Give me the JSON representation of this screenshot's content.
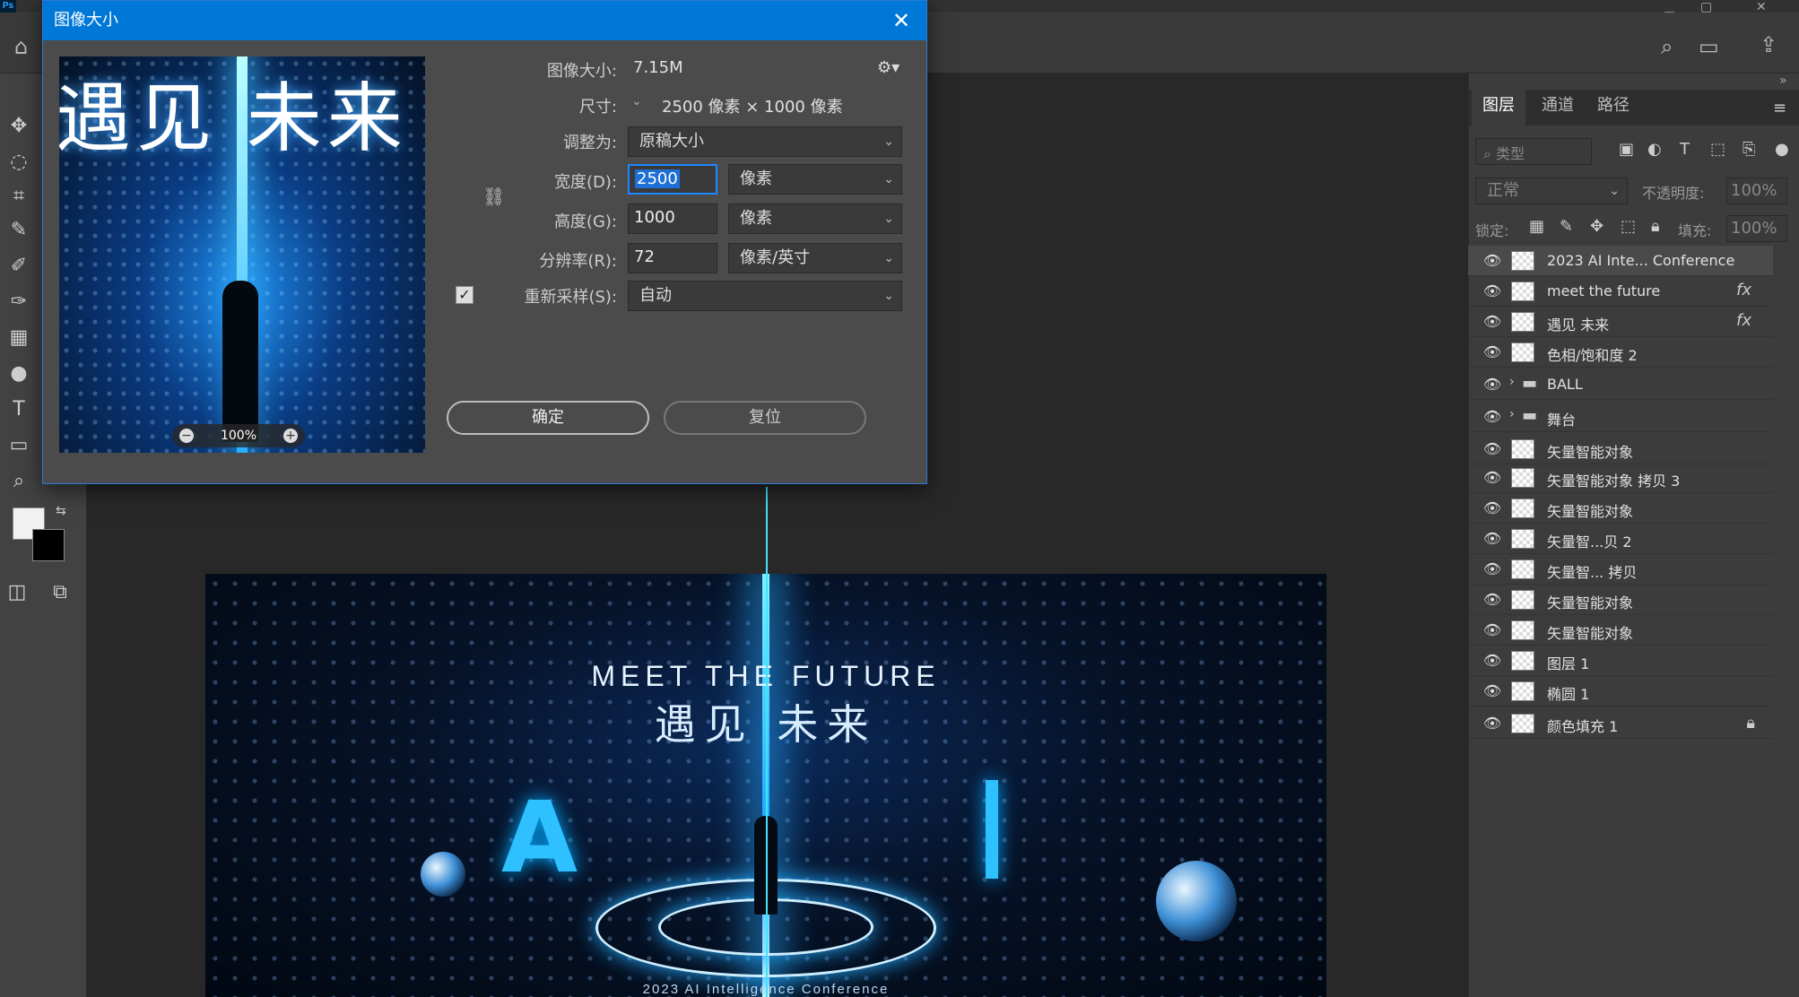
{
  "app": {
    "logo_text": "Ps"
  },
  "dialog": {
    "title": "图像大小",
    "close_icon": "close-icon",
    "image_size_label": "图像大小:",
    "image_size_value": "7.15M",
    "dimensions_label": "尺寸:",
    "dimensions_value": "2500 像素  ×  1000 像素",
    "fit_to_label": "调整为:",
    "fit_to_value": "原稿大小",
    "width_label": "宽度(D):",
    "width_value": "2500",
    "width_unit": "像素",
    "height_label": "高度(G):",
    "height_value": "1000",
    "height_unit": "像素",
    "resolution_label": "分辨率(R):",
    "resolution_value": "72",
    "resolution_unit": "像素/英寸",
    "resample_label": "重新采样(S):",
    "resample_value": "自动",
    "resample_checked": true,
    "ok_label": "确定",
    "reset_label": "复位",
    "preview_zoom": "100%",
    "preview_text": "遇见  未来"
  },
  "canvas": {
    "title_en": "MEET THE FUTURE",
    "title_cn": "遇见  未来",
    "letter_a": "A",
    "footer": "2023 AI Intelligence Conference"
  },
  "layers_panel": {
    "tabs": [
      "图层",
      "通道",
      "路径"
    ],
    "active_tab": 0,
    "filter_placeholder": "类型",
    "blend_mode": "正常",
    "opacity_label": "不透明度:",
    "opacity_value": "100%",
    "lock_label": "锁定:",
    "fill_label": "填充:",
    "fill_value": "100%",
    "layers": [
      {
        "name": "2023 AI Inte... Conference",
        "fx": false,
        "selected": true
      },
      {
        "name": "meet the future",
        "fx": true
      },
      {
        "name": "遇见  未来",
        "fx": true
      },
      {
        "name": "色相/饱和度 2",
        "fx": false
      },
      {
        "name": "BALL",
        "fx": false,
        "group": true
      },
      {
        "name": "舞台",
        "fx": false,
        "group": true
      },
      {
        "name": "矢量智能对象",
        "fx": false
      },
      {
        "name": "矢量智能对象 拷贝 3",
        "fx": false
      },
      {
        "name": "矢量智能对象",
        "fx": false
      },
      {
        "name": "矢量智...贝 2",
        "fx": false
      },
      {
        "name": "矢量智... 拷贝",
        "fx": false
      },
      {
        "name": "矢量智能对象",
        "fx": false
      },
      {
        "name": "矢量智能对象",
        "fx": false
      },
      {
        "name": "图层 1",
        "fx": false
      },
      {
        "name": "椭圆 1",
        "fx": false
      },
      {
        "name": "颜色填充 1",
        "fx": false,
        "locked": true
      }
    ],
    "fx_label": "fx"
  },
  "colors": {
    "accent": "#0078d7",
    "ui_bg": "#3c3c3c",
    "guide": "#46e0ff"
  }
}
